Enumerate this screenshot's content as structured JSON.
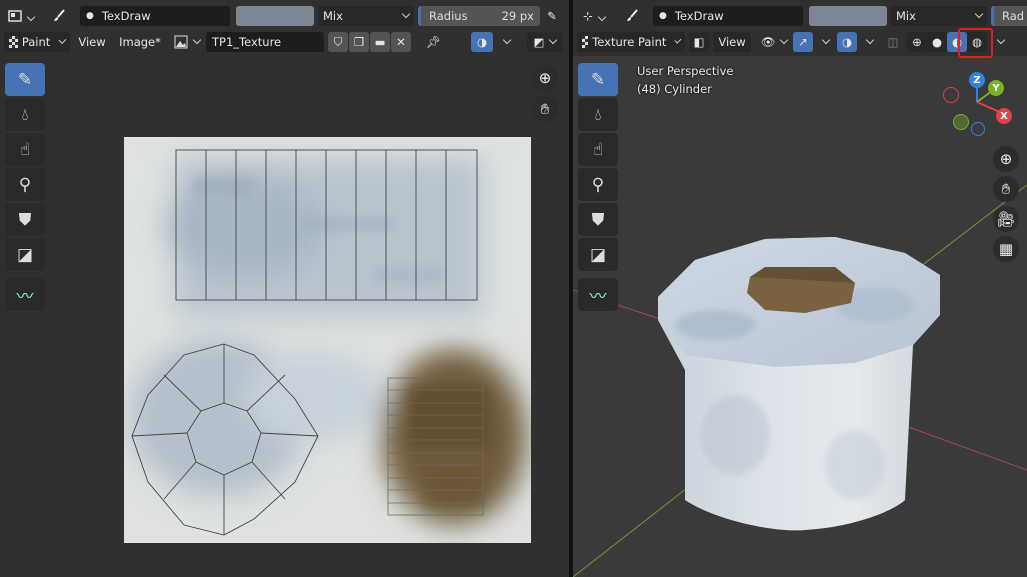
{
  "left_editor": {
    "tool_header": {
      "brush_name": "TexDraw",
      "blend_mode": "Mix",
      "radius_label": "Radius",
      "radius_value": "29 px"
    },
    "header": {
      "mode": "Paint",
      "menus": [
        "View",
        "Image*"
      ],
      "image_name": "TP1_Texture"
    },
    "tools": [
      "draw",
      "soften",
      "smear",
      "clone",
      "fill",
      "mask",
      "annotate"
    ]
  },
  "right_editor": {
    "tool_header": {
      "brush_name": "TexDraw",
      "blend_mode": "Mix",
      "radius_label": "Rad"
    },
    "header": {
      "mode": "Texture Paint",
      "menus": [
        "View"
      ]
    },
    "overlay": {
      "perspective": "User Perspective",
      "object": "(48) Cylinder"
    },
    "gizmo_axes": [
      "Z",
      "Y",
      "X"
    ],
    "highlighted_control": "material-preview-shading-button",
    "colors": {
      "accent": "#4772b3",
      "highlight": "#e02020",
      "x_axis": "#e0424c",
      "y_axis": "#79b12d",
      "z_axis": "#2f84e3"
    }
  }
}
